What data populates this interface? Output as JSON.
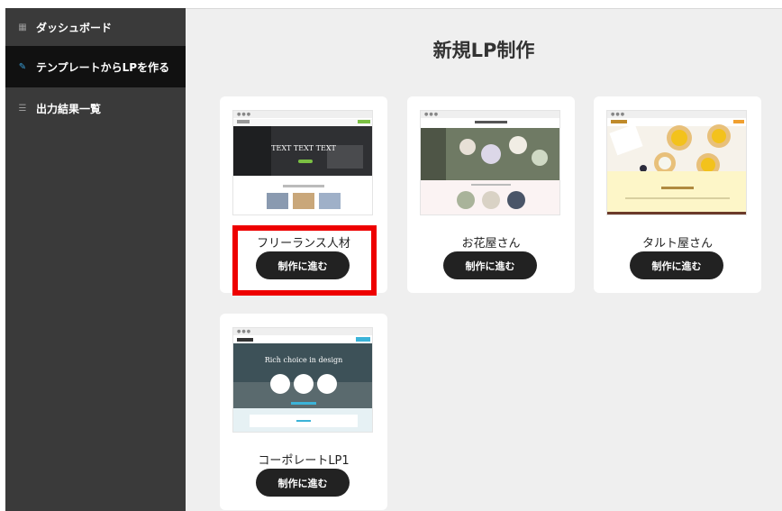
{
  "sidebar": {
    "items": [
      {
        "label": "ダッシュボード",
        "icon": "dashboard-icon"
      },
      {
        "label": "テンプレートからLPを作る",
        "icon": "edit-icon"
      },
      {
        "label": "出力結果一覧",
        "icon": "list-icon"
      }
    ]
  },
  "main": {
    "title": "新規LP制作",
    "templates": [
      {
        "label": "フリーランス人材",
        "button": "制作に進む",
        "hero_text": "TEXT TEXT TEXT"
      },
      {
        "label": "お花屋さん",
        "button": "制作に進む"
      },
      {
        "label": "タルト屋さん",
        "button": "制作に進む"
      },
      {
        "label": "コーポレートLP1",
        "button": "制作に進む",
        "hero_text": "Rich choice in design"
      }
    ]
  },
  "colors": {
    "sidebar": "#3a3a3a",
    "sidebar_active": "#111111",
    "background": "#efefef",
    "button": "#222222",
    "highlight": "#ee0000"
  }
}
